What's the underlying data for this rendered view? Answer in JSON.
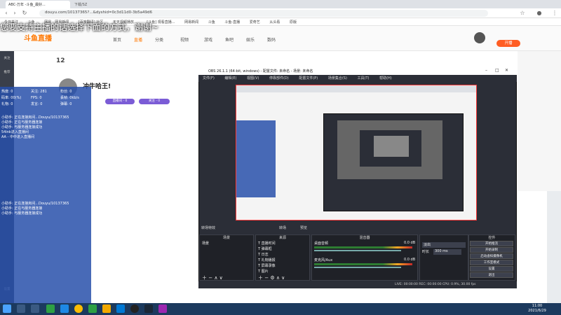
{
  "browser": {
    "tab_title": "ABC-万年 -斗鱼_最好...",
    "tab2_title": "下载/SZ",
    "url": "douyu.com/10137365?...&dyshid=0c3d11d0-3b5a49d6",
    "bookmarks": [
      "今日关注",
      "斗鱼",
      "网易 - 网易新闻",
      "[百度翻译] 社区",
      "天天视频播放...",
      "[斗鱼] 观看直播...",
      "网易新闻",
      "斗鱼",
      "斗鱼-直播",
      "爱奇艺",
      "从头看",
      "原版"
    ]
  },
  "danmu": "您要支持主播的话选择下面的方式，谢谢~",
  "site": {
    "logo": "斗鱼直播",
    "nav": [
      "首页",
      "直播",
      "分类",
      "视频",
      "游戏",
      "鱼吧",
      "娱乐",
      "数码"
    ],
    "live_badge": "开播"
  },
  "sidebar": [
    "关注",
    "推荐",
    "历史",
    "直播",
    "活动",
    "任务",
    "设置"
  ],
  "room": {
    "num": "12",
    "title": "冲牛哈王!",
    "tag_a": "直播间 - 0",
    "tag_b": "关注 - 0"
  },
  "stats": {
    "rows": [
      [
        "热度: 0",
        "关注: 281",
        "粉丝: 0"
      ],
      [
        "码率: 00(%)",
        "FPS: 0",
        "丢帧: 0kb/s"
      ],
      [
        "礼物: 0",
        "发言: 0",
        "弹幕: 0"
      ]
    ],
    "log_top": [
      "小助手: 正在连接房间...Douyu/10137365",
      "小助手: 正在与服务器连接",
      "小助手: 与服务器连接成功",
      "54ink进入直播间",
      "AA - 中中进入直播间"
    ],
    "log_bottom": [
      "小助手: 正在连接房间...Douyu/10137365",
      "小助手: 正在与服务器连接",
      "小助手: 与服务器连接成功"
    ]
  },
  "obs": {
    "title": "OBS 26.1.1 (64-bit, windows) - 配置文件: 未命名 - 场景: 未命名",
    "menu": [
      "文件(F)",
      "编辑(E)",
      "视图(V)",
      "停靠部件(D)",
      "配置文件(P)",
      "场景集合(S)",
      "工具(T)",
      "帮助(H)"
    ],
    "scenes_title": "场景",
    "scene_item": "场景",
    "sources_title": "来源",
    "sources": [
      "直播时间",
      "弹幕框",
      "日志",
      "礼物播报",
      "屏幕录像",
      "图片",
      "视频"
    ],
    "mixer_title": "混音器",
    "mixer": [
      "桌面音频",
      "麦克风/Aux"
    ],
    "mixer_db": [
      "0.0 dB",
      "0.0 dB"
    ],
    "transitions_title": "转场特效",
    "transition": "淡出",
    "duration_label": "时长",
    "duration": "300 ms",
    "controls_title": "控件",
    "controls": [
      "开始推流",
      "开始录制",
      "启动虚拟摄像机",
      "工作室模式",
      "设置",
      "退出"
    ],
    "label_preview": "转场",
    "label_program": "预览",
    "statusbar": "LIVE: 00:00:00   REC: 00:00:00   CPU: 0.9%, 30.00 fps"
  },
  "taskbar": {
    "time": "11:00",
    "date": "2021/6/29"
  }
}
